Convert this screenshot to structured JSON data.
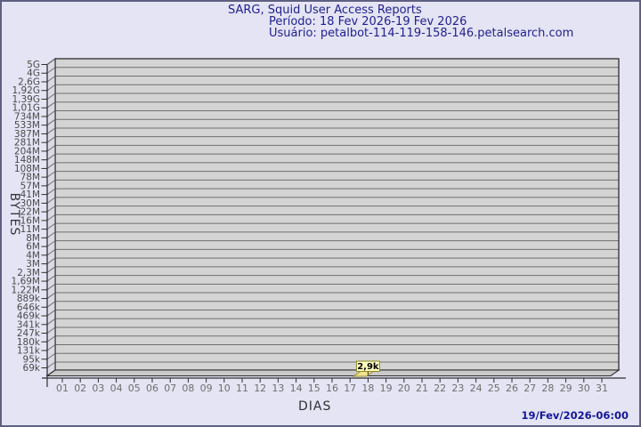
{
  "header": {
    "title": "SARG, Squid User Access Reports",
    "period": "Período: 18 Fev 2026-19 Fev 2026",
    "user": "Usuário: petalbot-114-119-158-146.petalsearch.com"
  },
  "footer": {
    "timestamp": "19/Fev/2026-06:00"
  },
  "chart_data": {
    "type": "bar",
    "title": "SARG, Squid User Access Reports",
    "subtitle_period": "Período: 18 Fev 2026-19 Fev 2026",
    "subtitle_user": "Usuário: petalbot-114-119-158-146.petalsearch.com",
    "xlabel": "DIAS",
    "ylabel": "BYTES",
    "x_tick_labels": [
      "01",
      "02",
      "03",
      "04",
      "05",
      "06",
      "07",
      "08",
      "09",
      "10",
      "11",
      "12",
      "13",
      "14",
      "15",
      "16",
      "17",
      "18",
      "19",
      "20",
      "21",
      "22",
      "23",
      "24",
      "25",
      "26",
      "27",
      "28",
      "29",
      "30",
      "31"
    ],
    "y_tick_labels": [
      "5G",
      "4G",
      "2,6G",
      "1,92G",
      "1,39G",
      "1,01G",
      "734M",
      "533M",
      "387M",
      "281M",
      "204M",
      "148M",
      "108M",
      "78M",
      "57M",
      "41M",
      "30M",
      "22M",
      "16M",
      "11M",
      "8M",
      "6M",
      "4M",
      "3M",
      "2,3M",
      "1,69M",
      "1,22M",
      "889k",
      "646k",
      "469k",
      "341k",
      "247k",
      "180k",
      "131k",
      "95k",
      "69k"
    ],
    "y_scale": "log",
    "grid": true,
    "legend": false,
    "points": [
      {
        "x": "18",
        "value_label": "2,9k",
        "value_bytes": 2900
      }
    ]
  },
  "colors": {
    "page_background": "#e4e4f4",
    "title_text": "#1f1f8e",
    "timestamp_text": "#15159b",
    "plot_face": "#d4d4d4",
    "plot_wall": "#dadae6",
    "plot_floor": "#c9c9c9",
    "grid_line": "#6f6f6f",
    "axis_line": "#2e2e2e",
    "y_tick_text": "#4a4a4a",
    "x_tick_text": "#6e6e6e",
    "bar_fill": "#f2e490",
    "bar_stroke": "#9c8f2a",
    "value_box_fill": "#ffffc2",
    "value_box_stroke": "#8a8a20",
    "value_text": "#000000"
  }
}
